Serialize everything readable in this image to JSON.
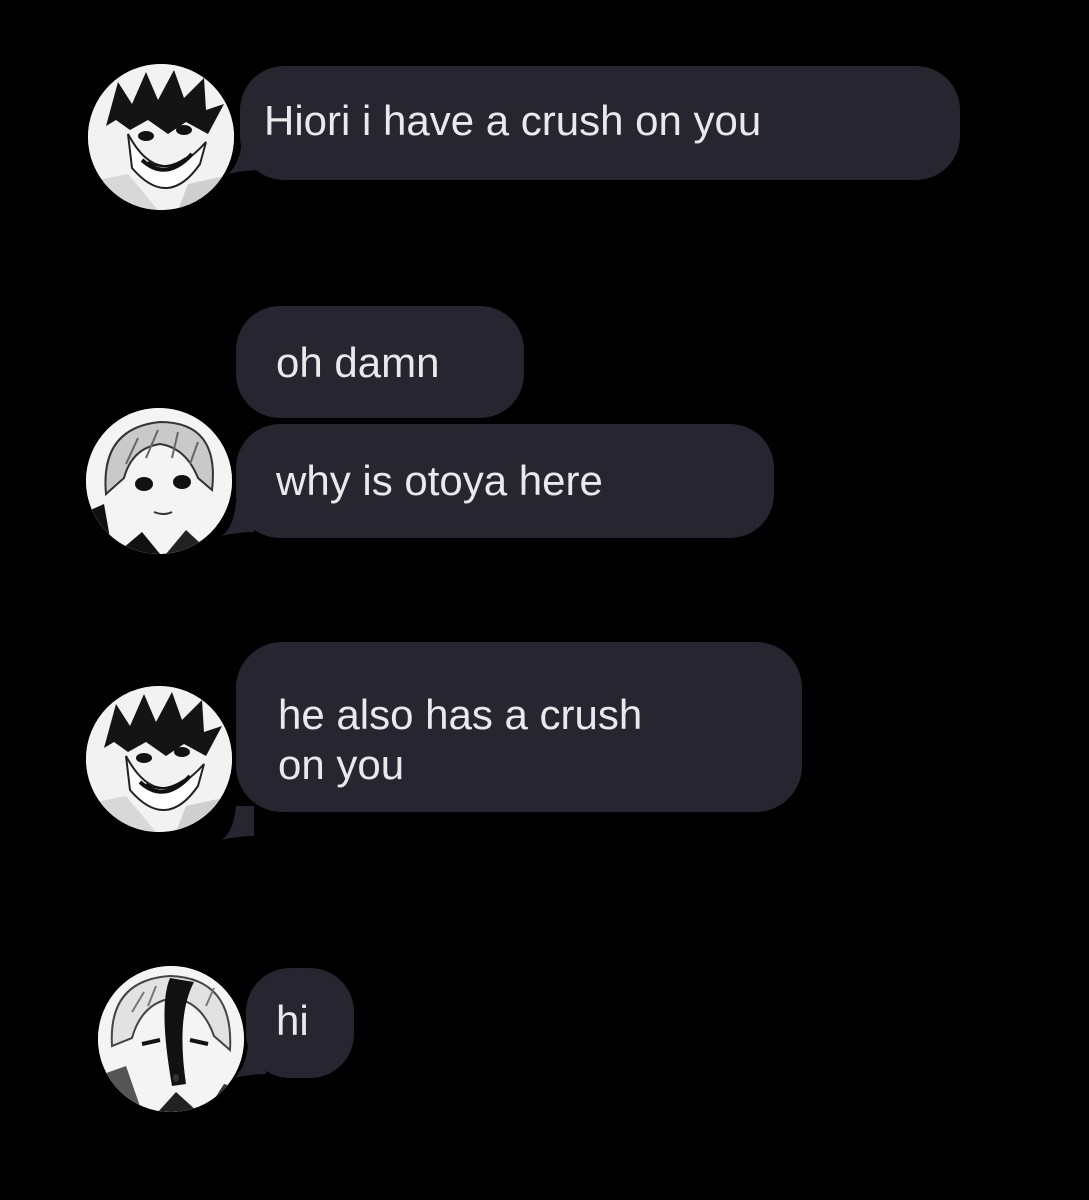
{
  "theme": {
    "background": "#000000",
    "bubble_color": "#262530",
    "text_color": "#e9e9ec"
  },
  "messages": [
    {
      "avatar_icon": "spiky-dark-hair-grinning-avatar-icon",
      "lines": [
        "Hiori i have a crush on you"
      ]
    },
    {
      "avatar_icon": null,
      "lines": [
        "oh damn"
      ]
    },
    {
      "avatar_icon": "light-bob-hair-avatar-icon",
      "lines": [
        "why is otoya  here"
      ]
    },
    {
      "avatar_icon": "spiky-dark-hair-grinning-avatar-icon",
      "lines": [
        " he also has a crush",
        "on you"
      ]
    },
    {
      "avatar_icon": "two-tone-hair-avatar-icon",
      "lines": [
        "hi"
      ]
    }
  ]
}
